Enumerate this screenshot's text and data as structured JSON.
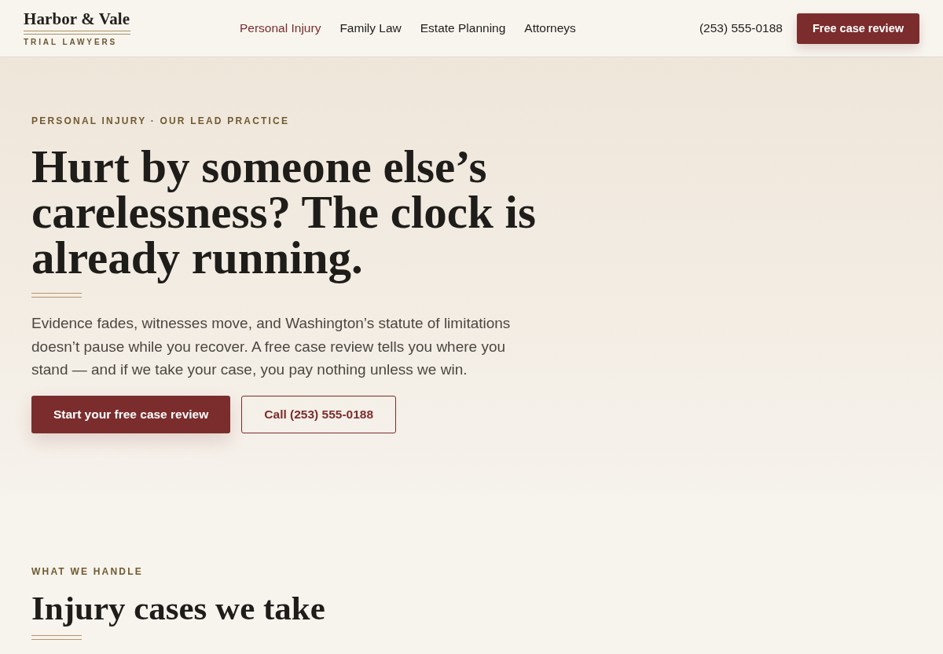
{
  "header": {
    "logo": {
      "name": "Harbor & Vale",
      "tagline": "TRIAL LAWYERS"
    },
    "nav": [
      {
        "label": "Personal Injury",
        "selected": true
      },
      {
        "label": "Family Law",
        "selected": false
      },
      {
        "label": "Estate Planning",
        "selected": false
      },
      {
        "label": "Attorneys",
        "selected": false
      }
    ],
    "phone": "(253) 555-0188",
    "cta": "Free case review"
  },
  "hero": {
    "eyebrow": "PERSONAL INJURY · OUR LEAD PRACTICE",
    "headline": "Hurt by someone else’s carelessness? The clock is already running.",
    "body": "Evidence fades, witnesses move, and Washington’s statute of limitations doesn’t pause while you recover. A free case review tells you where you stand — and if we take your case, you pay nothing unless we win.",
    "buttons": [
      {
        "label": "Start your free case review",
        "kind": "primary"
      },
      {
        "label": "Call (253) 555-0188",
        "kind": "outline"
      }
    ]
  },
  "section": {
    "eyebrow": "WHAT WE HANDLE",
    "heading": "Injury cases we take"
  }
}
